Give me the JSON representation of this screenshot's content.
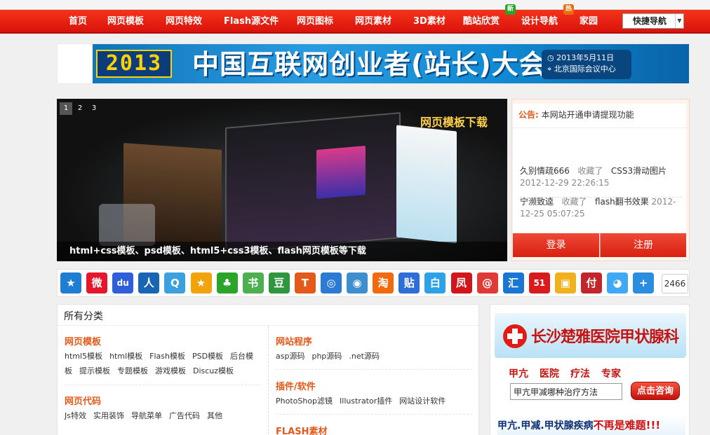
{
  "nav": {
    "items": [
      "首页",
      "网页模板",
      "网页特效",
      "Flash源文件",
      "网页图标",
      "网页素材",
      "3D素材",
      "酷站欣赏",
      "设计导航",
      "家园"
    ],
    "badge_new": "新",
    "badge_hot": "热",
    "quick_nav": "快捷导航",
    "badge_new_color": "#2aa52a",
    "badge_hot_color": "#e76e0b"
  },
  "top_banner": {
    "year": "2013",
    "title": "中国互联网创业者(站长)大会",
    "date": "2013年5月11日",
    "venue": "北京国际会议中心"
  },
  "slider": {
    "pages": [
      "1",
      "2",
      "3"
    ],
    "active_page": "1",
    "heading": "网页模板下载",
    "caption": "html+css模板、psd模板、html5+css3模板、flash网页模板等下载"
  },
  "notice": {
    "label": "公告:",
    "text": "本网站开通申请提现功能",
    "activities": [
      {
        "user": "久别情疏666",
        "action": "收藏了",
        "item": "CSS3滑动图片",
        "time": "2012-12-29 22:26:15"
      },
      {
        "user": "宁濒致逵",
        "action": "收藏了",
        "item": "flash翻书效果",
        "time": "2012-12-25 05:07:25"
      }
    ],
    "login": "登录",
    "register": "注册"
  },
  "share": {
    "icons": [
      {
        "name": "qzone-star-icon",
        "glyph": "★",
        "color": "#1e7fd2"
      },
      {
        "name": "sina-weibo-icon",
        "glyph": "微",
        "color": "#e6162d"
      },
      {
        "name": "baidu-icon",
        "glyph": "du",
        "color": "#2e5fd8"
      },
      {
        "name": "renren-icon",
        "glyph": "人",
        "color": "#1865b5"
      },
      {
        "name": "qq-weibo-icon",
        "glyph": "Q",
        "color": "#3aa0de"
      },
      {
        "name": "pengyou-icon",
        "glyph": "★",
        "color": "#f0a30a"
      },
      {
        "name": "kaixin-icon",
        "glyph": "♣",
        "color": "#2aa52a"
      },
      {
        "name": "bookmark-icon",
        "glyph": "书",
        "color": "#4caf50"
      },
      {
        "name": "douban-icon",
        "glyph": "豆",
        "color": "#2e963d"
      },
      {
        "name": "tianya-icon",
        "glyph": "T",
        "color": "#e35a1b"
      },
      {
        "name": "people-icon",
        "glyph": "◎",
        "color": "#2b7ad4"
      },
      {
        "name": "sohu-icon",
        "glyph": "◉",
        "color": "#3f8fcf"
      },
      {
        "name": "taobao-icon",
        "glyph": "淘",
        "color": "#f36a0c"
      },
      {
        "name": "tieba-icon",
        "glyph": "贴",
        "color": "#2e6ed8"
      },
      {
        "name": "baidu-bai-icon",
        "glyph": "白",
        "color": "#2ea2e8"
      },
      {
        "name": "phoenix-icon",
        "glyph": "凤",
        "color": "#d2151b"
      },
      {
        "name": "netease-icon",
        "glyph": "@",
        "color": "#e03a36"
      },
      {
        "name": "hui-icon",
        "glyph": "汇",
        "color": "#1976d2"
      },
      {
        "name": "51-icon",
        "glyph": "51",
        "color": "#d81b1b"
      },
      {
        "name": "box-icon",
        "glyph": "▣",
        "color": "#f1b11c"
      },
      {
        "name": "xianguo-icon",
        "glyph": "付",
        "color": "#c2262c"
      },
      {
        "name": "qq-icon",
        "glyph": "◕",
        "color": "#3fa9f5"
      },
      {
        "name": "more-share-icon",
        "glyph": "+",
        "color": "#2a8de0"
      }
    ],
    "count": "2466"
  },
  "categories": {
    "title": "所有分类",
    "left": [
      {
        "heading": "网页模板",
        "links": [
          "html5模板",
          "html模板",
          "Flash模板",
          "PSD模板",
          "后台模",
          "板",
          "提示模板",
          "专题模板",
          "游戏模板",
          "Discuz模板"
        ]
      },
      {
        "heading": "网页代码",
        "links": [
          "Js特效",
          "实用装饰",
          "导航菜单",
          "广告代码",
          "其他"
        ]
      }
    ],
    "right": [
      {
        "heading": "网站程序",
        "links": [
          "asp源码",
          "php源码",
          ".net源码"
        ]
      },
      {
        "heading": "插件/软件",
        "links": [
          "PhotoShop滤镜",
          "Illustrator插件",
          "网站设计软件"
        ]
      },
      {
        "heading": "FLASH素材",
        "links": []
      }
    ]
  },
  "ad": {
    "title": "长沙楚雅医院甲状腺科",
    "tags": [
      "甲亢",
      "医院",
      "疗法",
      "专家"
    ],
    "input_value": "甲亢甲减哪种治疗方法",
    "button": "点击咨询",
    "bottom_text": "甲亢.甲减.甲状腺疾病",
    "bottom_emphasis": "不再是难题!!!"
  }
}
